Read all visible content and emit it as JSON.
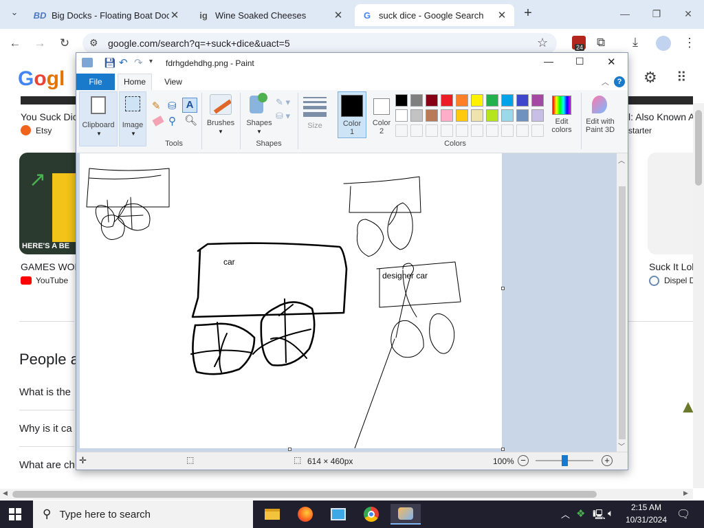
{
  "browser": {
    "tabs": [
      {
        "title": "Big Docks - Floating Boat Dock",
        "favicon": "BD"
      },
      {
        "title": "Wine Soaked Cheeses",
        "favicon": "ig"
      },
      {
        "title": "suck dice - Google Search",
        "favicon": "G"
      }
    ],
    "url": "google.com/search?q=+suck+dice&uact=5",
    "extensions_badge": "24"
  },
  "google": {
    "result1_title": "You Suck Dic",
    "result1_source": "Etsy",
    "result2_title": "GAMES WOR",
    "result2_source": "YouTube",
    "thumb_text": "HERE'S A BE",
    "right_title": "l: Also Known A",
    "right_source": "starter",
    "right2_title": "Suck It Lol",
    "right2_source": "Dispel D",
    "people_heading": "People a",
    "q1": "What is the",
    "q2": "Why is it ca",
    "q3": "What are ch"
  },
  "paint": {
    "title": "fdrhgdehdhg.png - Paint",
    "menu": {
      "file": "File",
      "home": "Home",
      "view": "View"
    },
    "ribbon": {
      "clipboard": "Clipboard",
      "image": "Image",
      "tools": "Tools",
      "brushes": "Brushes",
      "shapes": "Shapes",
      "shapes_group": "Shapes",
      "size": "Size",
      "color1": "Color\n1",
      "color2": "Color\n2",
      "colors": "Colors",
      "edit_colors": "Edit\ncolors",
      "edit_paint3d": "Edit with\nPaint 3D"
    },
    "palette_row1": [
      "#000000",
      "#7f7f7f",
      "#880015",
      "#ed1c24",
      "#ff7f27",
      "#fff200",
      "#22b14c",
      "#00a2e8",
      "#3f48cc",
      "#a349a4"
    ],
    "palette_row2": [
      "#ffffff",
      "#c3c3c3",
      "#b97a57",
      "#ffaec9",
      "#ffc90e",
      "#efe4b0",
      "#b5e61d",
      "#99d9ea",
      "#7092be",
      "#c8bfe7"
    ],
    "canvas_labels": {
      "car": "car",
      "designer_car": "designer car"
    },
    "status": {
      "dimensions": "614 × 460px",
      "zoom": "100%"
    }
  },
  "taskbar": {
    "search_placeholder": "Type here to search",
    "time": "2:15 AM",
    "date": "10/31/2024"
  }
}
